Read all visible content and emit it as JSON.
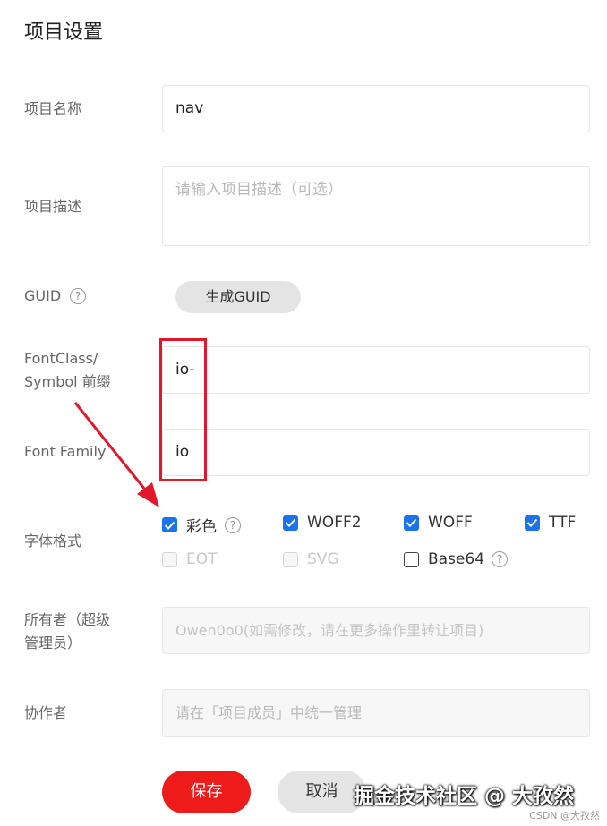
{
  "page": {
    "title": "项目设置"
  },
  "fields": {
    "name": {
      "label": "项目名称",
      "value": "nav"
    },
    "description": {
      "label": "项目描述",
      "placeholder": "请输入项目描述（可选）"
    },
    "guid": {
      "label": "GUID",
      "help": "?",
      "button": "生成GUID"
    },
    "prefix": {
      "label_line1": "FontClass/",
      "label_line2": "Symbol 前缀",
      "value": "io-"
    },
    "family": {
      "label": "Font Family",
      "value": "io"
    },
    "formats": {
      "label": "字体格式",
      "items": [
        {
          "label": "彩色",
          "checked": true,
          "help": "?"
        },
        {
          "label": "WOFF2",
          "checked": true
        },
        {
          "label": "WOFF",
          "checked": true
        },
        {
          "label": "TTF",
          "checked": true
        },
        {
          "label": "EOT",
          "checked": false,
          "disabled": true
        },
        {
          "label": "SVG",
          "checked": false,
          "disabled": true
        },
        {
          "label": "Base64",
          "checked": false,
          "help": "?"
        }
      ]
    },
    "owner": {
      "label_line1": "所有者（超级",
      "label_line2": "管理员）",
      "value": "Owen0o0(如需修改，请在更多操作里转让项目)"
    },
    "collaborators": {
      "label": "协作者",
      "placeholder": "请在「项目成员」中统一管理"
    }
  },
  "actions": {
    "save": "保存",
    "cancel": "取消"
  },
  "watermark": "掘金技术社区 @ 大孜然",
  "credit": "CSDN @大孜然",
  "colors": {
    "primary": "#ee1b1b",
    "checkbox": "#1a73e8",
    "annotation": "#e3172b"
  }
}
